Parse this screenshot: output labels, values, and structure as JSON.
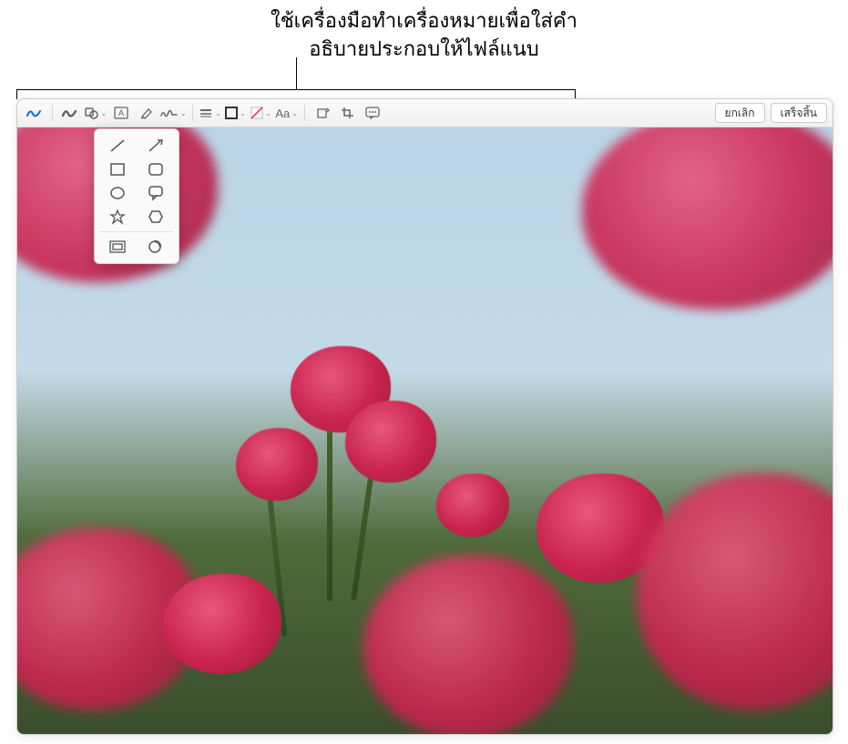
{
  "callout": {
    "line1": "ใช้เครื่องมือทำเครื่องหมายเพื่อใส่คำ",
    "line2": "อธิบายประกอบให้ไฟล์แนบ"
  },
  "toolbar": {
    "tools": {
      "sketch": "sketch",
      "draw": "draw",
      "shapes": "shapes",
      "text": "text",
      "highlight": "highlight",
      "sign": "sign",
      "alignment": "alignment",
      "stroke_color": "stroke-color",
      "fill_color": "fill-color",
      "text_style": "text-style",
      "rotate": "rotate",
      "crop": "crop",
      "describe": "describe"
    },
    "text_style_label": "Aa"
  },
  "actions": {
    "cancel": "ยกเลิก",
    "done": "เสร็จสิ้น"
  },
  "shapes_popover": {
    "rows": [
      [
        "line",
        "arrow"
      ],
      [
        "square",
        "rounded-square"
      ],
      [
        "circle",
        "speech-bubble"
      ],
      [
        "star",
        "hexagon"
      ],
      [
        "mask",
        "loupe"
      ]
    ]
  }
}
